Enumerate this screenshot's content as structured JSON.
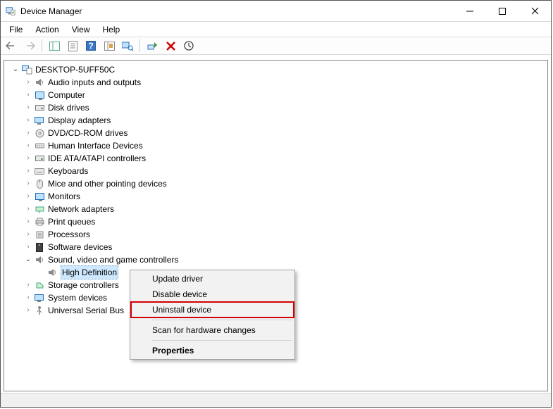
{
  "window": {
    "title": "Device Manager"
  },
  "menu": {
    "file": "File",
    "action": "Action",
    "view": "View",
    "help": "Help"
  },
  "tree": {
    "root": "DESKTOP-5UFF50C",
    "items": [
      "Audio inputs and outputs",
      "Computer",
      "Disk drives",
      "Display adapters",
      "DVD/CD-ROM drives",
      "Human Interface Devices",
      "IDE ATA/ATAPI controllers",
      "Keyboards",
      "Mice and other pointing devices",
      "Monitors",
      "Network adapters",
      "Print queues",
      "Processors",
      "Software devices",
      "Sound, video and game controllers",
      "Storage controllers",
      "System devices",
      "Universal Serial Bus"
    ],
    "expanded_child": "High Definition"
  },
  "context_menu": {
    "update": "Update driver",
    "disable": "Disable device",
    "uninstall": "Uninstall device",
    "scan": "Scan for hardware changes",
    "properties": "Properties"
  }
}
